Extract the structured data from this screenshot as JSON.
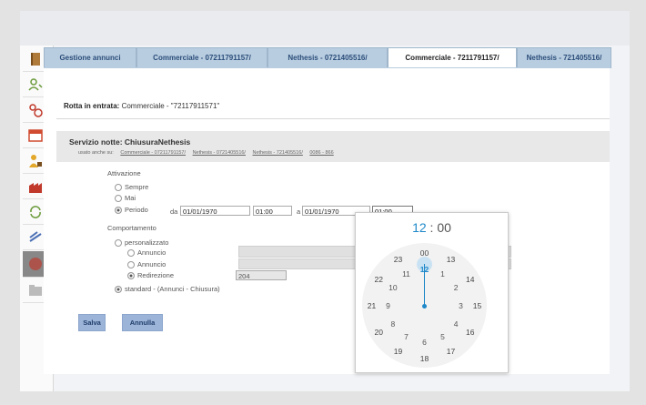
{
  "tabs": [
    {
      "label": "Gestione annunci"
    },
    {
      "label": "Commerciale - 07211791157/"
    },
    {
      "label": "Nethesis - 0721405516/"
    },
    {
      "label": "Commerciale - 7211791157/"
    },
    {
      "label": "Nethesis - 721405516/"
    }
  ],
  "route": {
    "label": "Rotta in entrata:",
    "value": "Commerciale - \"72117911571\""
  },
  "service": {
    "title": "Servizio notte: ChiusuraNethesis",
    "links_prefix": "usato anche su:",
    "links": [
      "Commerciale - 07211791157/",
      "Nethesis - 0721405516/",
      "Nethesis - 721405516/",
      "0086 - 866"
    ]
  },
  "activation": {
    "label": "Attivazione",
    "always": "Sempre",
    "never": "Mai",
    "period": "Periodo",
    "from_label": "da",
    "from_date": "01/01/1970",
    "from_time": "01:00",
    "to_label": "a",
    "to_date": "01/01/1970",
    "to_time": "01:00"
  },
  "behaviour": {
    "label": "Comportamento",
    "custom": "personalizzato",
    "announce1": "Annuncio",
    "announce2": "Annuncio",
    "redirect": "Redirezione",
    "redirect_value": "204",
    "standard": "standard - (Annunci - Chiusura)"
  },
  "buttons": {
    "save": "Salva",
    "cancel": "Annulla"
  },
  "clock": {
    "hours": "12",
    "separator": ":",
    "minutes": "00",
    "outer": [
      "00",
      "13",
      "14",
      "15",
      "16",
      "17",
      "18",
      "19",
      "20",
      "21",
      "22",
      "23"
    ],
    "inner": [
      "12",
      "1",
      "2",
      "3",
      "4",
      "5",
      "6",
      "7",
      "8",
      "9",
      "10",
      "11"
    ]
  }
}
